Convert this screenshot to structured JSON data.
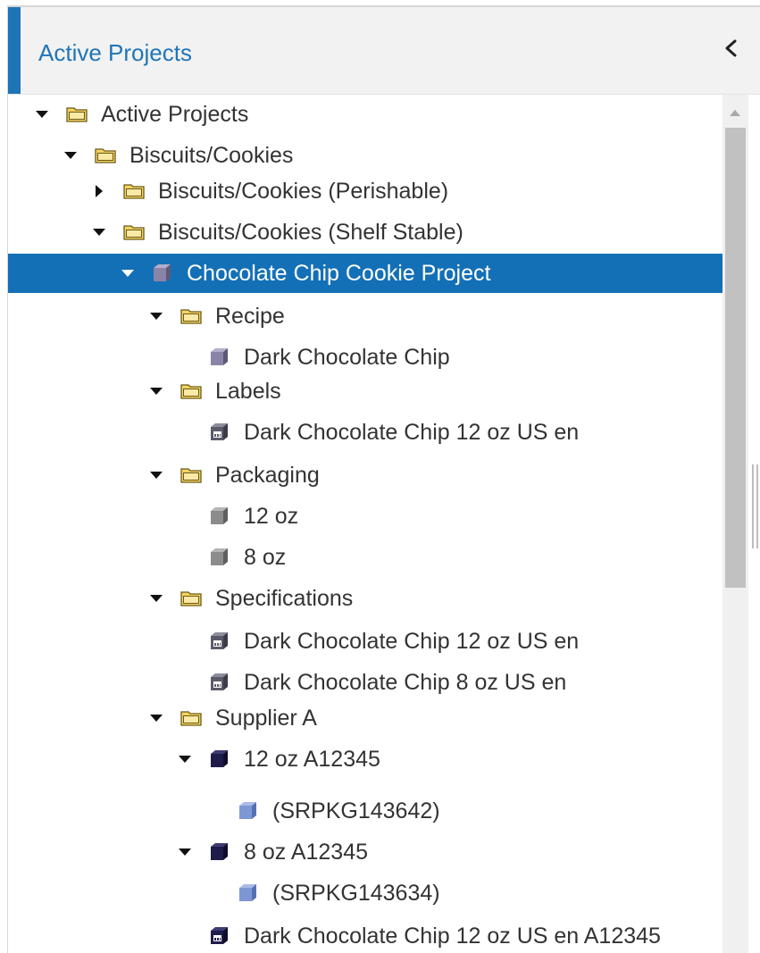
{
  "header": {
    "title": "Active Projects",
    "accent_color": "#1d74b6",
    "collapse_icon": "chevron-left-icon"
  },
  "colors": {
    "selection": "#1470b6",
    "folder": "#f5d35f",
    "item_purple": "#8a84a8",
    "item_gray": "#8c8c8c",
    "item_navy": "#1e1c4a",
    "item_blue": "#7e97d4"
  },
  "tree": {
    "nodes": [
      {
        "label": "Active Projects",
        "icon": "folder",
        "caret": "expanded",
        "depth": 0
      },
      {
        "label": "Biscuits/Cookies",
        "icon": "folder",
        "caret": "expanded",
        "depth": 1
      },
      {
        "label": "Biscuits/Cookies (Perishable)",
        "icon": "folder",
        "caret": "collapsed",
        "depth": 2
      },
      {
        "label": "Biscuits/Cookies (Shelf Stable)",
        "icon": "folder",
        "caret": "expanded",
        "depth": 2
      },
      {
        "label": "Chocolate Chip Cookie Project",
        "icon": "cube-purple",
        "caret": "expanded",
        "depth": 3,
        "selected": true
      },
      {
        "label": "Recipe",
        "icon": "folder",
        "caret": "expanded",
        "depth": 4
      },
      {
        "label": "Dark Chocolate Chip",
        "icon": "cube-purple",
        "caret": "none",
        "depth": 5
      },
      {
        "label": "Labels",
        "icon": "folder",
        "caret": "expanded",
        "depth": 4
      },
      {
        "label": "Dark Chocolate Chip 12 oz US en",
        "icon": "spec",
        "caret": "none",
        "depth": 5
      },
      {
        "label": "Packaging",
        "icon": "folder",
        "caret": "expanded",
        "depth": 4
      },
      {
        "label": "12 oz",
        "icon": "cube-gray",
        "caret": "none",
        "depth": 5
      },
      {
        "label": "8 oz",
        "icon": "cube-gray",
        "caret": "none",
        "depth": 5
      },
      {
        "label": "Specifications",
        "icon": "folder",
        "caret": "expanded",
        "depth": 4
      },
      {
        "label": "Dark Chocolate Chip 12 oz US en",
        "icon": "spec",
        "caret": "none",
        "depth": 5
      },
      {
        "label": "Dark Chocolate Chip 8 oz US en",
        "icon": "spec",
        "caret": "none",
        "depth": 5
      },
      {
        "label": "Supplier A",
        "icon": "folder",
        "caret": "expanded",
        "depth": 4
      },
      {
        "label": "12 oz A12345",
        "icon": "cube-navy",
        "caret": "expanded",
        "depth": 5
      },
      {
        "label": "(SRPKG143642)",
        "icon": "cube-blue",
        "caret": "none",
        "depth": 6
      },
      {
        "label": "8 oz A12345",
        "icon": "cube-navy",
        "caret": "expanded",
        "depth": 5
      },
      {
        "label": "(SRPKG143634)",
        "icon": "cube-blue",
        "caret": "none",
        "depth": 6
      },
      {
        "label": "Dark Chocolate Chip 12 oz US en A12345",
        "icon": "spec-navy",
        "caret": "none",
        "depth": 5
      }
    ]
  }
}
